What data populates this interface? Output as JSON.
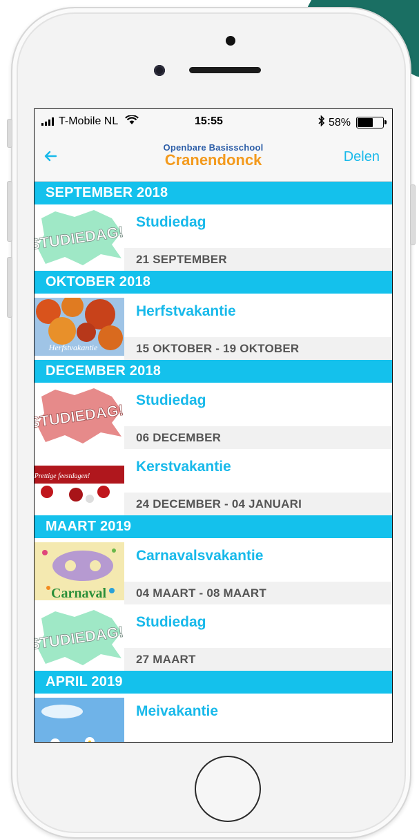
{
  "status_bar": {
    "carrier": "T-Mobile NL",
    "time": "15:55",
    "battery": "58%",
    "battery_level": 0.58
  },
  "nav": {
    "brand_top": "Openbare Basisschool",
    "brand_main": "Cranendonck",
    "share_label": "Delen",
    "back_icon": "back-arrow-icon"
  },
  "sections": [
    {
      "header": "SEPTEMBER 2018",
      "events": [
        {
          "title": "Studiedag",
          "date": "21 SEPTEMBER",
          "thumb_text": "STUDIEDAG!"
        }
      ]
    },
    {
      "header": "OKTOBER 2018",
      "events": [
        {
          "title": "Herfstvakantie",
          "date": "15 OKTOBER - 19 OKTOBER",
          "thumb_text": "Herfstvakantie"
        }
      ]
    },
    {
      "header": "DECEMBER 2018",
      "events": [
        {
          "title": "Studiedag",
          "date": "06 DECEMBER",
          "thumb_text": "STUDIEDAG!"
        },
        {
          "title": "Kerstvakantie",
          "date": "24 DECEMBER - 04 JANUARI",
          "thumb_text": "Prettige feestdagen!"
        }
      ]
    },
    {
      "header": "MAART 2019",
      "events": [
        {
          "title": "Carnavalsvakantie",
          "date": "04 MAART - 08 MAART",
          "thumb_text": "Carnaval"
        },
        {
          "title": "Studiedag",
          "date": "27 MAART",
          "thumb_text": "STUDIEDAG!"
        }
      ]
    },
    {
      "header": "APRIL 2019",
      "events": [
        {
          "title": "Meivakantie",
          "date": ""
        }
      ]
    }
  ],
  "colors": {
    "accent": "#14c1ec",
    "link": "#18b9ea",
    "brand_orange": "#f39a1d",
    "brand_blue": "#2e5fa8",
    "corner": "#1a6f63"
  }
}
